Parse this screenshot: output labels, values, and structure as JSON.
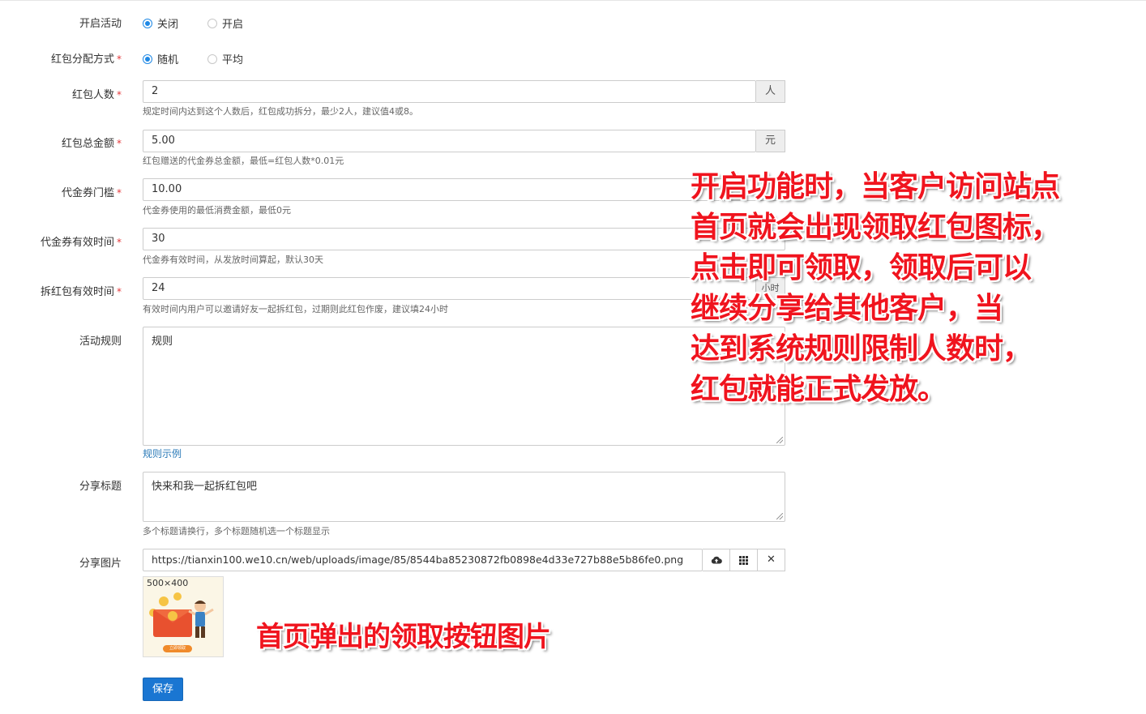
{
  "form": {
    "activity": {
      "label": "开启活动",
      "options": [
        "关闭",
        "开启"
      ],
      "selected": "关闭"
    },
    "distribution": {
      "label": "红包分配方式",
      "required": "*",
      "options": [
        "随机",
        "平均"
      ],
      "selected": "随机"
    },
    "people": {
      "label": "红包人数",
      "required": "*",
      "value": "2",
      "unit": "人",
      "help": "规定时间内达到这个人数后，红包成功拆分，最少2人，建议值4或8。"
    },
    "total": {
      "label": "红包总金额",
      "required": "*",
      "value": "5.00",
      "unit": "元",
      "help": "红包赠送的代金券总金额，最低=红包人数*0.01元"
    },
    "threshold": {
      "label": "代金券门槛",
      "required": "*",
      "value": "10.00",
      "help": "代金券使用的最低消费金额，最低0元"
    },
    "valid_days": {
      "label": "代金券有效时间",
      "required": "*",
      "value": "30",
      "help": "代金券有效时间，从发放时间算起，默认30天"
    },
    "split_time": {
      "label": "拆红包有效时间",
      "required": "*",
      "value": "24",
      "unit": "小时",
      "help": "有效时间内用户可以邀请好友一起拆红包，过期则此红包作废，建议填24小时"
    },
    "rules": {
      "label": "活动规则",
      "value": "规则",
      "link": "规则示例"
    },
    "share_title": {
      "label": "分享标题",
      "value": "快来和我一起拆红包吧",
      "help": "多个标题请换行，多个标题随机选一个标题显示"
    },
    "share_image": {
      "label": "分享图片",
      "value": "https://tianxin100.we10.cn/web/uploads/image/85/8544ba85230872fb0898e4d33e727b88e5b86fe0.png",
      "thumb_size": "500×400",
      "thumb_button": "立即领取"
    },
    "save_label": "保存"
  },
  "annotations": {
    "main_lines": [
      "开启功能时，当客户访问站点",
      "首页就会出现领取红包图标，",
      "点击即可领取，领取后可以",
      "继续分享给其他客户，当",
      "达到系统规则限制人数时，",
      "红包就能正式发放。"
    ],
    "image_note": "首页弹出的领取按钮图片"
  },
  "colors": {
    "primary": "#1a76d2",
    "annotation": "#f0141e",
    "required": "#e4393c"
  }
}
